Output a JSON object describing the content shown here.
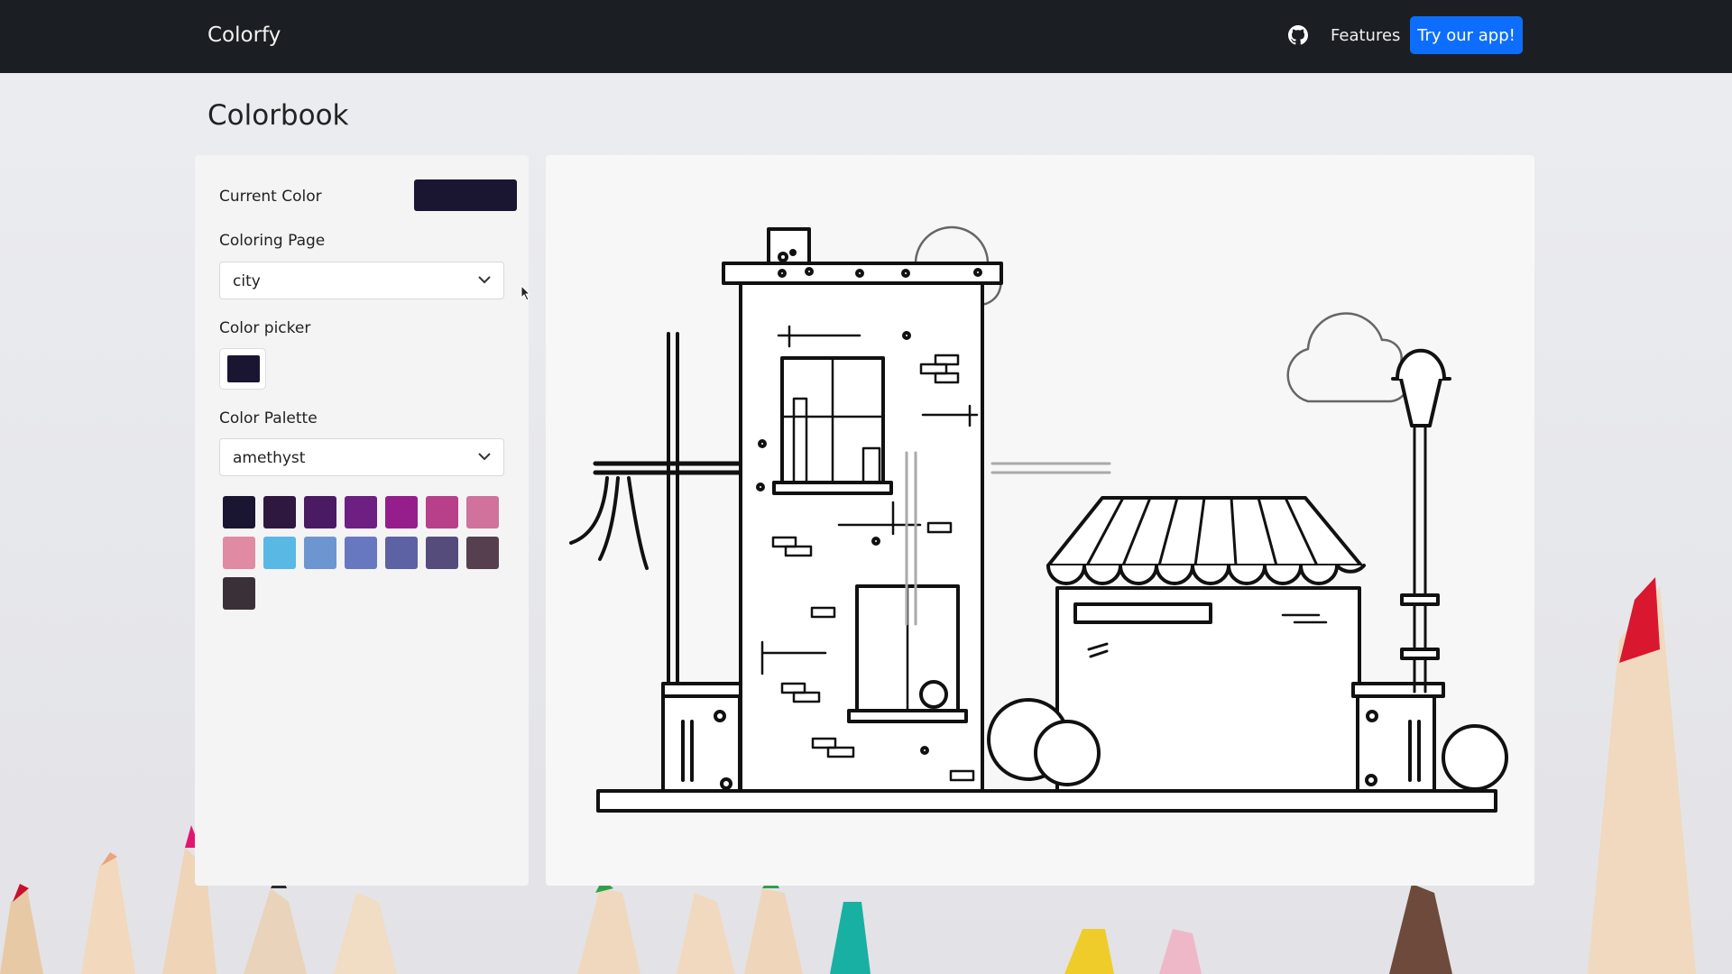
{
  "navbar": {
    "brand": "Colorfy",
    "features_label": "Features",
    "cta_label": "Try our app!"
  },
  "page": {
    "title": "Colorbook"
  },
  "panel": {
    "current_color_label": "Current Color",
    "current_color": "#1a1632",
    "coloring_page_label": "Coloring Page",
    "coloring_page_value": "city",
    "color_picker_label": "Color picker",
    "color_palette_label": "Color Palette",
    "color_palette_value": "amethyst",
    "swatches": [
      "#1a1632",
      "#2e1840",
      "#4a1b62",
      "#6e1f82",
      "#961e8c",
      "#b8408a",
      "#d0729c",
      "#e08aa4",
      "#5ab8e4",
      "#6d96d0",
      "#6878c0",
      "#5c62a4",
      "#564c7c",
      "#564050",
      "#3a3038"
    ]
  },
  "icons": {
    "github": "github-icon",
    "chevron": "chevron-down-icon"
  }
}
